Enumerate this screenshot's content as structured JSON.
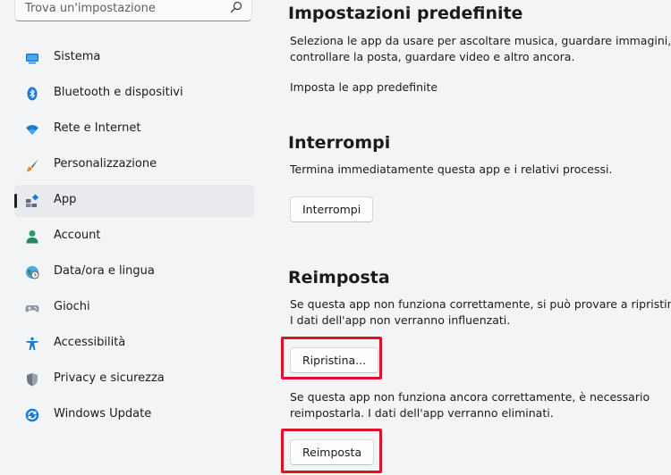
{
  "search": {
    "text": "Trova un'impostazione"
  },
  "sidebar": {
    "items": [
      {
        "label": "Sistema",
        "icon": "system-icon"
      },
      {
        "label": "Bluetooth e dispositivi",
        "icon": "bluetooth-icon"
      },
      {
        "label": "Rete e Internet",
        "icon": "wifi-icon"
      },
      {
        "label": "Personalizzazione",
        "icon": "brush-icon"
      },
      {
        "label": "App",
        "icon": "apps-icon",
        "selected": true
      },
      {
        "label": "Account",
        "icon": "person-icon"
      },
      {
        "label": "Data/ora e lingua",
        "icon": "globe-clock-icon"
      },
      {
        "label": "Giochi",
        "icon": "gamepad-icon"
      },
      {
        "label": "Accessibilità",
        "icon": "accessibility-icon"
      },
      {
        "label": "Privacy e sicurezza",
        "icon": "shield-icon"
      },
      {
        "label": "Windows Update",
        "icon": "update-icon"
      }
    ]
  },
  "defaults": {
    "title": "Impostazioni predefinite",
    "line1": "Seleziona le app da usare per ascoltare musica, guardare immagini,",
    "line2": "controllare la posta, guardare video e altro ancora.",
    "link": "Imposta le app predefinite"
  },
  "terminate": {
    "title": "Interrompi",
    "desc": "Termina immediatamente questa app e i relativi processi.",
    "button": "Interrompi"
  },
  "reset": {
    "title": "Reimposta",
    "repair_line1": "Se questa app non funziona correttamente, si può provare a ripristinarla.",
    "repair_line2": "I dati dell'app non verranno influenzati.",
    "repair_button": "Ripristina...",
    "reset_line1": "Se questa app non funziona ancora correttamente, è necessario",
    "reset_line2": "reimpostarla. I dati dell'app verranno eliminati.",
    "reset_button": "Reimposta"
  },
  "colors": {
    "highlight": "#e0102b",
    "background": "#f3f4f6"
  }
}
